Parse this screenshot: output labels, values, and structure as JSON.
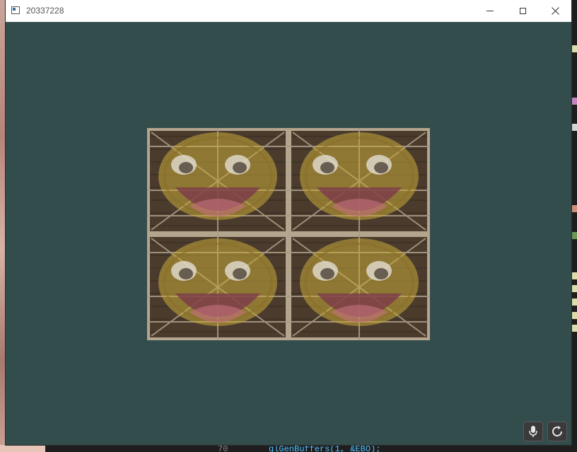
{
  "window": {
    "title": "20337228",
    "controls": {
      "minimize_icon": "minimize-icon",
      "maximize_icon": "maximize-icon",
      "close_icon": "close-icon"
    },
    "clear_color": "#334d4d"
  },
  "scene": {
    "texture_layers": [
      "wooden-container-texture",
      "awesomeface-texture"
    ],
    "tiles": 4
  },
  "background_editor": {
    "line_number": "70",
    "code": "glGenBuffers(1, &EBO);"
  },
  "floating_buttons": {
    "mic_icon": "microphone-icon",
    "sync_icon": "sync-icon"
  }
}
